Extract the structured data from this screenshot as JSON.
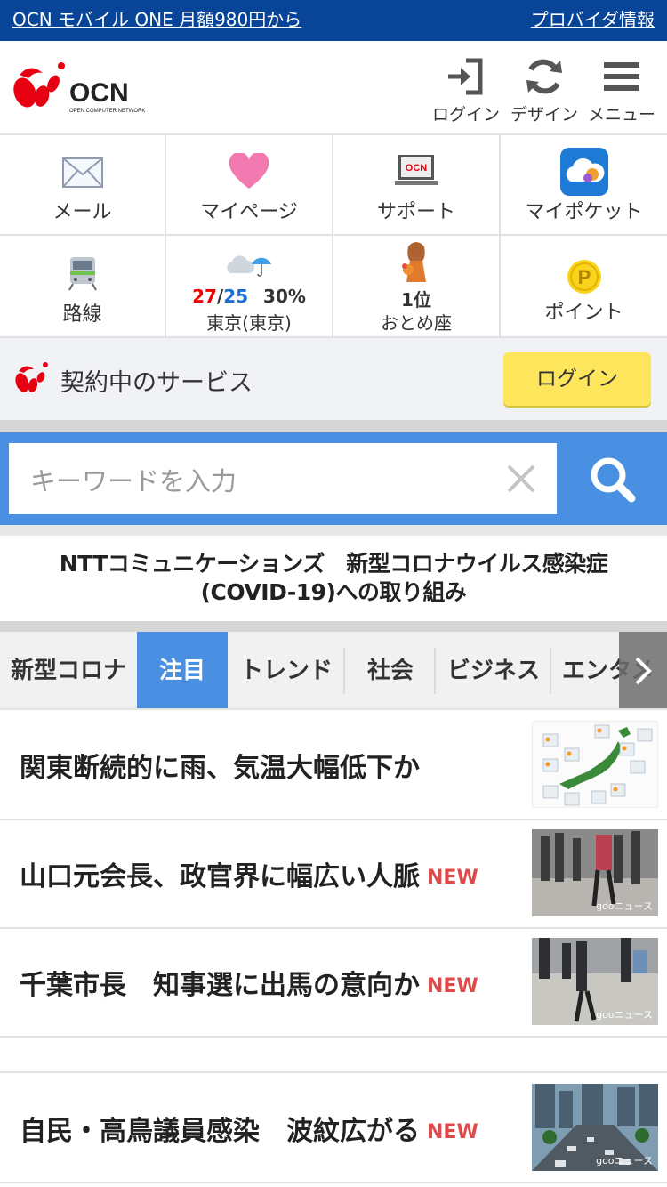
{
  "banner": {
    "promo_link": "OCN モバイル ONE 月額980円から",
    "provider_link": "プロバイダ情報",
    "bg_color": "#084497"
  },
  "header": {
    "logo": {
      "text": "OCN",
      "subtext": "OPEN COMPUTER NETWORK"
    },
    "login_label": "ログイン",
    "design_label": "デザイン",
    "menu_label": "メニュー"
  },
  "services": {
    "mail": "メール",
    "mypage": "マイページ",
    "support": "サポート",
    "support_icon_text": "OCN",
    "mypocket": "マイポケット",
    "route": "路線",
    "weather": {
      "high": "27",
      "slash": "/",
      "low": "25",
      "precip": "30%",
      "location": "東京(東京)"
    },
    "horoscope": {
      "rank": "1位",
      "sign": "おとめ座"
    },
    "point": "ポイント",
    "point_icon": "P"
  },
  "contract": {
    "label": "契約中のサービス",
    "login_button": "ログイン"
  },
  "search": {
    "placeholder": "キーワードを入力"
  },
  "notice": {
    "line1": "NTTコミュニケーションズ　新型コロナウイルス感染症",
    "line2": "(COVID-19)への取り組み"
  },
  "tabs": [
    {
      "label": "新型コロナ"
    },
    {
      "label": "注目"
    },
    {
      "label": "トレンド"
    },
    {
      "label": "社会"
    },
    {
      "label": "ビジネス"
    },
    {
      "label": "エンタメ"
    }
  ],
  "news": [
    {
      "title": "関東断続的に雨、気温大幅低下か",
      "new": "",
      "source": ""
    },
    {
      "title": "山口元会長、政官界に幅広い人脈",
      "new": "NEW",
      "source": "gooニュース"
    },
    {
      "title": "千葉市長　知事選に出馬の意向か",
      "new": "NEW",
      "source": "gooニュース"
    },
    {
      "title": "自民・高鳥議員感染　波紋広がる",
      "new": "NEW",
      "source": "gooニュース"
    }
  ],
  "colors": {
    "accent_blue": "#4a90e2",
    "new_red": "#e04949",
    "login_yellow": "#fde55c"
  }
}
